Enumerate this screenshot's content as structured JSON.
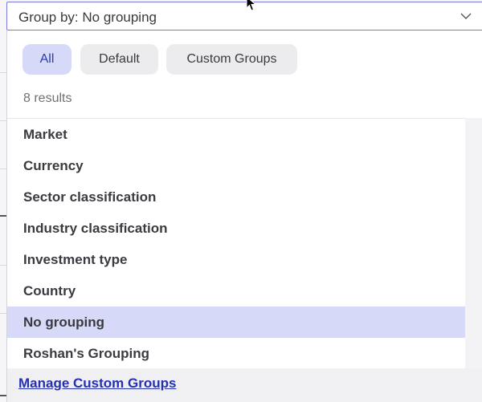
{
  "group_by": {
    "label": "Group by: No grouping",
    "chevron_icon": "chevron-down-icon"
  },
  "filters": {
    "all": "All",
    "default": "Default",
    "custom": "Custom Groups",
    "active": "All"
  },
  "results": {
    "count_text": "8 results"
  },
  "options": [
    {
      "label": "Market"
    },
    {
      "label": "Currency"
    },
    {
      "label": "Sector classification"
    },
    {
      "label": "Industry classification"
    },
    {
      "label": "Investment type"
    },
    {
      "label": "Country"
    },
    {
      "label": "No grouping",
      "selected": true
    },
    {
      "label": "Roshan's Grouping"
    }
  ],
  "footer": {
    "manage_link": "Manage Custom Groups"
  },
  "colors": {
    "accent": "#2e3aa8",
    "selected_bg": "#d6daf8",
    "link": "#2430b0"
  }
}
